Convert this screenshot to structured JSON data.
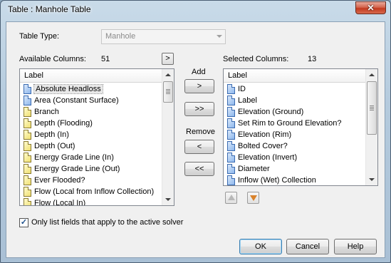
{
  "window": {
    "title": "Table : Manhole Table",
    "close_symbol": "✕"
  },
  "table_type": {
    "label": "Table Type:",
    "value": "Manhole"
  },
  "available": {
    "label": "Available Columns:",
    "count": "51",
    "header": "Label",
    "expand_label": ">",
    "items": [
      {
        "label": "Absolute Headloss",
        "icon": "blue-doc-icon",
        "selected": true
      },
      {
        "label": "Area (Constant Surface)",
        "icon": "blue-doc-icon"
      },
      {
        "label": "Branch",
        "icon": "yellow-doc-icon"
      },
      {
        "label": "Depth (Flooding)",
        "icon": "yellow-doc-icon"
      },
      {
        "label": "Depth (In)",
        "icon": "yellow-doc-icon"
      },
      {
        "label": "Depth (Out)",
        "icon": "yellow-doc-icon"
      },
      {
        "label": "Energy Grade Line (In)",
        "icon": "yellow-doc-icon"
      },
      {
        "label": "Energy Grade Line (Out)",
        "icon": "yellow-doc-icon"
      },
      {
        "label": "Ever Flooded?",
        "icon": "yellow-doc-icon"
      },
      {
        "label": "Flow (Local from Inflow Collection)",
        "icon": "yellow-doc-icon"
      },
      {
        "label": "Flow (Local In)",
        "icon": "yellow-doc-icon"
      }
    ]
  },
  "actions": {
    "add_label": "Add",
    "add_one": ">",
    "add_all": ">>",
    "remove_label": "Remove",
    "remove_one": "<",
    "remove_all": "<<"
  },
  "selected": {
    "label": "Selected Columns:",
    "count": "13",
    "header": "Label",
    "items": [
      {
        "label": "ID",
        "icon": "blue-doc-icon"
      },
      {
        "label": "Label",
        "icon": "blue-doc-icon"
      },
      {
        "label": "Elevation (Ground)",
        "icon": "blue-doc-icon"
      },
      {
        "label": "Set Rim to Ground Elevation?",
        "icon": "blue-doc-icon"
      },
      {
        "label": "Elevation (Rim)",
        "icon": "blue-doc-icon"
      },
      {
        "label": "Bolted Cover?",
        "icon": "blue-doc-icon"
      },
      {
        "label": "Elevation (Invert)",
        "icon": "blue-doc-icon"
      },
      {
        "label": "Diameter",
        "icon": "blue-doc-icon"
      },
      {
        "label": "Inflow (Wet) Collection",
        "icon": "blue-doc-icon"
      }
    ]
  },
  "checkbox": {
    "label": "Only list fields that apply to the active solver",
    "checked": true,
    "mark": "✓"
  },
  "footer": {
    "ok_label": "OK",
    "cancel_label": "Cancel",
    "help_label": "Help"
  }
}
